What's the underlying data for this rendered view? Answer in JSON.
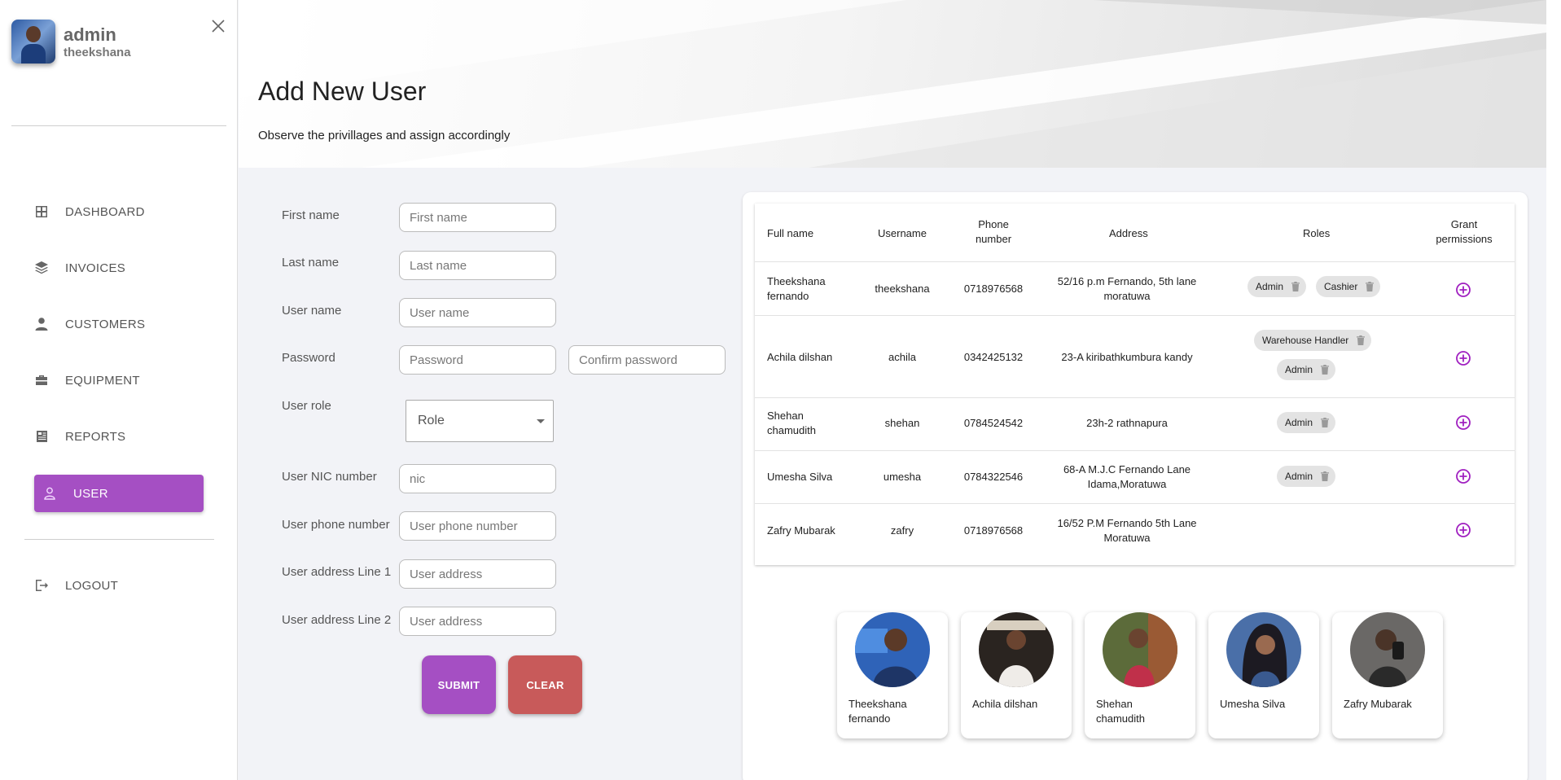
{
  "profile": {
    "name": "admin",
    "username": "theekshana"
  },
  "nav": {
    "items": [
      {
        "label": "DASHBOARD",
        "icon": "dashboard-icon"
      },
      {
        "label": "INVOICES",
        "icon": "layers-icon"
      },
      {
        "label": "CUSTOMERS",
        "icon": "person-icon"
      },
      {
        "label": "EQUIPMENT",
        "icon": "briefcase-icon"
      },
      {
        "label": "REPORTS",
        "icon": "newspaper-icon"
      },
      {
        "label": "USER",
        "icon": "person-outline-icon",
        "active": true
      }
    ],
    "logout": "LOGOUT"
  },
  "header": {
    "title": "Add New User",
    "subtitle": "Observe the privillages and assign accordingly"
  },
  "form": {
    "first_name": {
      "label": "First name",
      "placeholder": "First name"
    },
    "last_name": {
      "label": "Last name",
      "placeholder": "Last name"
    },
    "user_name": {
      "label": "User name",
      "placeholder": "User name"
    },
    "password": {
      "label": "Password",
      "placeholder": "Password",
      "confirm_placeholder": "Confirm password"
    },
    "user_role": {
      "label": "User role",
      "value": "Role"
    },
    "nic": {
      "label": "User NIC number",
      "placeholder": "nic"
    },
    "phone": {
      "label": "User phone number",
      "placeholder": "User phone number"
    },
    "address1": {
      "label": "User address Line 1",
      "placeholder": "User address"
    },
    "address2": {
      "label": "User address Line 2",
      "placeholder": "User address"
    },
    "submit_label": "SUBMIT",
    "clear_label": "CLEAR"
  },
  "table": {
    "headers": {
      "full_name": "Full name",
      "username": "Username",
      "phone_line1": "Phone",
      "phone_line2": "number",
      "address": "Address",
      "roles": "Roles",
      "grant_line1": "Grant",
      "grant_line2": "permissions"
    },
    "rows": [
      {
        "full_name_1": "Theekshana",
        "full_name_2": "fernando",
        "username": "theekshana",
        "phone": "0718976568",
        "address_1": "52/16 p.m Fernando, 5th lane",
        "address_2": "moratuwa",
        "roles": [
          "Admin",
          "Cashier"
        ]
      },
      {
        "full_name_1": "Achila dilshan",
        "full_name_2": "",
        "username": "achila",
        "phone": "0342425132",
        "address_1": "23-A kiribathkumbura kandy",
        "address_2": "",
        "roles": [
          "Warehouse Handler",
          "Admin"
        ]
      },
      {
        "full_name_1": "Shehan",
        "full_name_2": "chamudith",
        "username": "shehan",
        "phone": "0784524542",
        "address_1": "23h-2 rathnapura",
        "address_2": "",
        "roles": [
          "Admin"
        ]
      },
      {
        "full_name_1": "Umesha Silva",
        "full_name_2": "",
        "username": "umesha",
        "phone": "0784322546",
        "address_1": "68-A M.J.C Fernando Lane",
        "address_2": "Idama,Moratuwa",
        "roles": [
          "Admin"
        ]
      },
      {
        "full_name_1": "Zafry Mubarak",
        "full_name_2": "",
        "username": "zafry",
        "phone": "0718976568",
        "address_1": "16/52 P.M Fernando 5th Lane",
        "address_2": "Moratuwa",
        "roles": []
      }
    ]
  },
  "cards": [
    {
      "name_1": "Theekshana",
      "name_2": "fernando"
    },
    {
      "name_1": "Achila dilshan",
      "name_2": ""
    },
    {
      "name_1": "Shehan",
      "name_2": "chamudith"
    },
    {
      "name_1": "Umesha Silva",
      "name_2": ""
    },
    {
      "name_1": "Zafry Mubarak",
      "name_2": ""
    }
  ],
  "colors": {
    "accent": "#a54fc3",
    "danger": "#c85a5a",
    "chip": "#e3e3e3"
  }
}
